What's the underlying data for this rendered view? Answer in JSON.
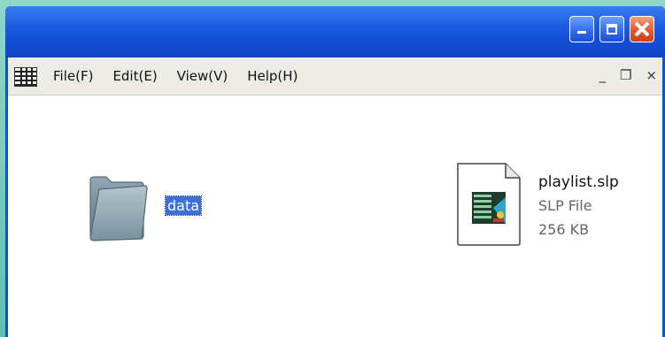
{
  "window": {
    "controls": {
      "minimize_icon": "minimize-icon",
      "maximize_icon": "maximize-icon",
      "close_icon": "close-icon"
    },
    "colors": {
      "titlebar": "#1e5fe4",
      "close_button": "#e25a2c",
      "menubar_bg": "#ecebe6",
      "selection": "#3c6fd8"
    }
  },
  "menubar": {
    "app_icon": "grid-app-icon",
    "items": [
      {
        "label": "File(F)"
      },
      {
        "label": "Edit(E)"
      },
      {
        "label": "View(V)"
      },
      {
        "label": "Help(H)"
      }
    ],
    "mdi": {
      "minimize": "_",
      "restore": "❐",
      "close": "×"
    }
  },
  "content": {
    "folder": {
      "icon": "folder-icon",
      "label": "data",
      "selected": true
    },
    "file": {
      "icon": "slp-file-icon",
      "name": "playlist.slp",
      "type": "SLP File",
      "size": "256 KB"
    }
  }
}
